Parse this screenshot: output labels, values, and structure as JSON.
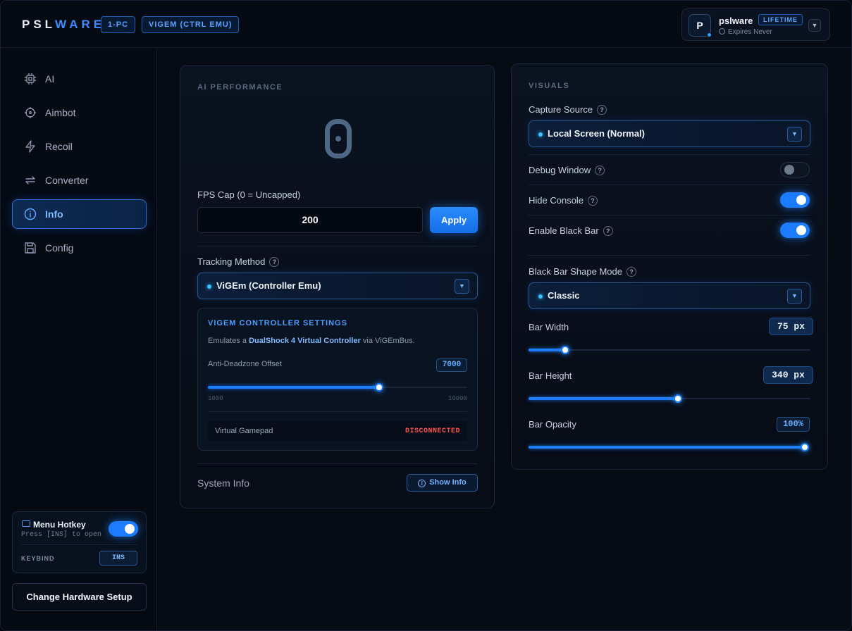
{
  "header": {
    "logo_part1": "PSL",
    "logo_part2": "WARE",
    "tags": [
      "1-PC",
      "VIGEM (CTRL EMU)"
    ],
    "user": {
      "avatar_letter": "P",
      "name": "pslware",
      "badge": "LIFETIME",
      "expires": "Expires Never"
    }
  },
  "sidebar": {
    "items": [
      {
        "label": "AI",
        "icon": "cpu-icon"
      },
      {
        "label": "Aimbot",
        "icon": "crosshair-icon"
      },
      {
        "label": "Recoil",
        "icon": "lightning-icon"
      },
      {
        "label": "Converter",
        "icon": "swap-arrows-icon"
      },
      {
        "label": "Info",
        "icon": "info-icon",
        "active": true
      },
      {
        "label": "Config",
        "icon": "save-icon"
      }
    ],
    "hotkey": {
      "title": "Menu Hotkey",
      "subtitle": "Press [INS] to open",
      "enabled": true,
      "keybind_label": "KEYBIND",
      "keybind_value": "INS"
    },
    "hardware_button": "Change Hardware Setup"
  },
  "ai_panel": {
    "section_title": "AI PERFORMANCE",
    "fps_display": "0",
    "fps_cap_label": "FPS Cap (0 = Uncapped)",
    "fps_cap_value": "200",
    "apply_label": "Apply",
    "tracking_label": "Tracking Method",
    "tracking_value": "ViGEm (Controller Emu)",
    "vigem": {
      "title": "VIGEM CONTROLLER SETTINGS",
      "desc_prefix": "Emulates a ",
      "desc_bold": "DualShock 4 Virtual Controller",
      "desc_suffix": " via ViGEmBus.",
      "deadzone_label": "Anti-Deadzone Offset",
      "deadzone_value": "7000",
      "deadzone_min": "1000",
      "deadzone_max": "10000",
      "gamepad_label": "Virtual Gamepad",
      "gamepad_status": "DISCONNECTED"
    },
    "system_info_label": "System Info",
    "show_info_label": "Show Info"
  },
  "visuals_panel": {
    "section_title": "VISUALS",
    "capture_label": "Capture Source",
    "capture_value": "Local Screen (Normal)",
    "debug_label": "Debug Window",
    "debug_on": false,
    "hide_console_label": "Hide Console",
    "hide_console_on": true,
    "black_bar_label": "Enable Black Bar",
    "black_bar_on": true,
    "shape_label": "Black Bar Shape Mode",
    "shape_value": "Classic",
    "bar_width_label": "Bar Width",
    "bar_width_value": "75 px",
    "bar_width_fraction": 0.13,
    "bar_height_label": "Bar Height",
    "bar_height_value": "340 px",
    "bar_height_fraction": 0.53,
    "bar_opacity_label": "Bar Opacity",
    "bar_opacity_value": "100%",
    "bar_opacity_fraction": 1.0
  },
  "colors": {
    "accent": "#1e7dff",
    "danger": "#ff5252",
    "background": "#060b14"
  }
}
